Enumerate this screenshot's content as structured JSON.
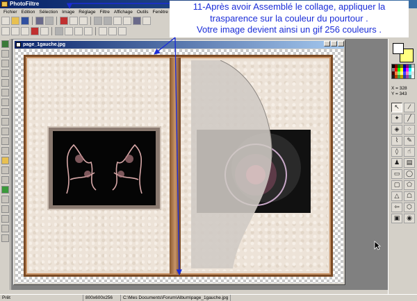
{
  "app": {
    "title": "PhotoFiltre"
  },
  "menu": [
    "Fichier",
    "Edition",
    "Sélection",
    "Image",
    "Réglage",
    "Filtre",
    "Affichage",
    "Outils",
    "Fenêtre"
  ],
  "document": {
    "title": "page_1gauche.jpg"
  },
  "annotation": {
    "line1": "11-Après avoir Assemblé le collage, appliquer la",
    "line2": "trasparence sur la couleur du pourtour .",
    "line3": "Votre image devient ainsi un  gif 256 couleurs ."
  },
  "coords": {
    "x": "X = 328",
    "y": "Y = 343"
  },
  "status": {
    "state": "Prêt",
    "size": "800x600x256",
    "path": "C:\\Mes Documents\\Forum\\Album\\page_1gauche.jpg"
  },
  "colors": {
    "accent": "#1a2cd8",
    "foreground_color": "#ffffff",
    "background_color": "#ffff80"
  },
  "tools": [
    "select-arrow-icon",
    "eyedropper-icon",
    "magic-wand-icon",
    "line-icon",
    "paint-bucket-icon",
    "spray-icon",
    "brush-icon",
    "pencil-icon",
    "blur-drop-icon",
    "finger-icon",
    "stamp-icon",
    "gradient-icon",
    "rectangle-icon",
    "ellipse-icon",
    "rounded-rect-icon",
    "polygon-icon",
    "triangle-icon",
    "lasso-icon",
    "arrow-tool-icon",
    "custom-shape-icon",
    "selection-rect-icon",
    "selection-ellipse-icon"
  ]
}
